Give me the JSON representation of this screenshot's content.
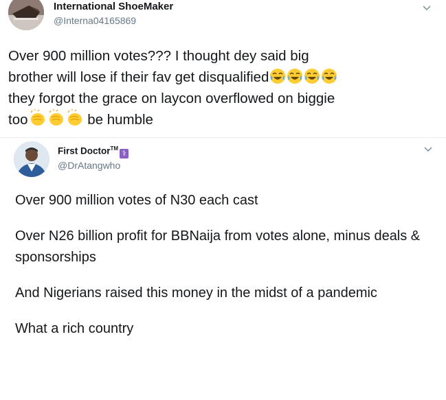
{
  "tweet1": {
    "author_name": "International ShoeMaker",
    "handle": "@Interna04165869",
    "line1": "Over 900 million votes??? I thought dey said big",
    "line2_text": "brother will lose if their fav get disqualified",
    "line3": "they forgot the grace on laycon overflowed on biggie",
    "line4_start": "too",
    "line4_end": " be humble",
    "laugh_emoji": "face-with-tears-of-joy",
    "clap_emoji": "clapping-hands"
  },
  "tweet2": {
    "author_name": "First Doctor",
    "tm": "TM",
    "badge_icon": "medical-symbol",
    "handle": "@DrAtangwho",
    "para1": "Over 900 million votes of N30 each cast",
    "para2": "Over N26 billion profit for BBNaija from votes alone, minus deals & sponsorships",
    "para3": "And Nigerians raised this money in the midst of a pandemic",
    "para4": "What a rich country"
  },
  "colors": {
    "text": "#14171a",
    "secondary": "#657786",
    "border": "#e6ecf0",
    "emoji_yellow": "#ffcc33",
    "tear_blue": "#5dadec"
  }
}
